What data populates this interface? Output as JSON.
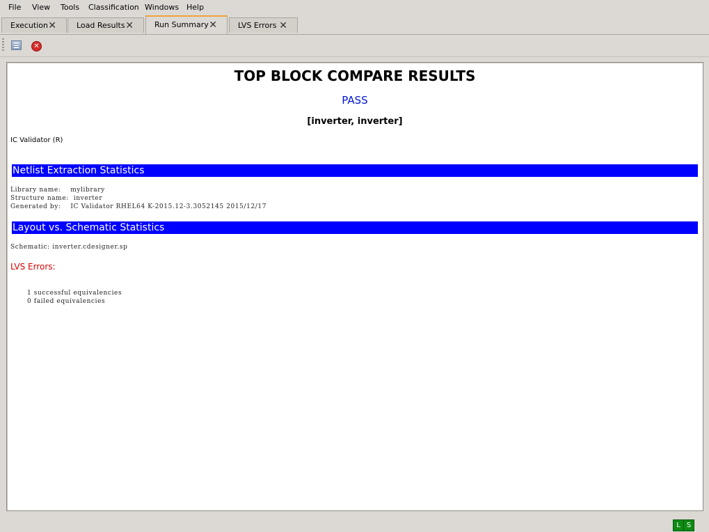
{
  "menu": [
    {
      "label": "File"
    },
    {
      "label": "View"
    },
    {
      "label": "Tools"
    },
    {
      "label": "Classification"
    },
    {
      "label": "Windows"
    },
    {
      "label": "Help"
    }
  ],
  "tabs": [
    {
      "label": "Execution",
      "active": false
    },
    {
      "label": "Load Results",
      "active": false
    },
    {
      "label": "Run Summary",
      "active": true
    },
    {
      "label": "LVS Errors",
      "active": false
    }
  ],
  "toolbar": {
    "icons": [
      "summary-icon",
      "stop-icon"
    ]
  },
  "report": {
    "title": "TOP BLOCK COMPARE RESULTS",
    "status": "PASS",
    "cells": "[inverter, inverter]",
    "tool": "IC Validator (R)",
    "netlist_section": "Netlist Extraction Statistics",
    "library_line": "Library name:    mylibrary",
    "structure_line": "Structure name:  inverter",
    "generated_line": "Generated by:    IC Validator RHEL64 K-2015.12-3.3052145 2015/12/17",
    "lvs_section": "Layout vs. Schematic Statistics",
    "schematic_line": "Schematic: inverter.cdesigner.sp",
    "lvs_errors_label": "LVS Errors:",
    "success_line": "1 successful equivalencies",
    "failed_line": "0 failed equivalencies"
  },
  "statusbar": {
    "badges": [
      "L",
      "S"
    ]
  },
  "colors": {
    "pass": "#0014d6",
    "section_bg": "#0000ff",
    "error": "#d60000",
    "badge": "#0e8a14"
  }
}
